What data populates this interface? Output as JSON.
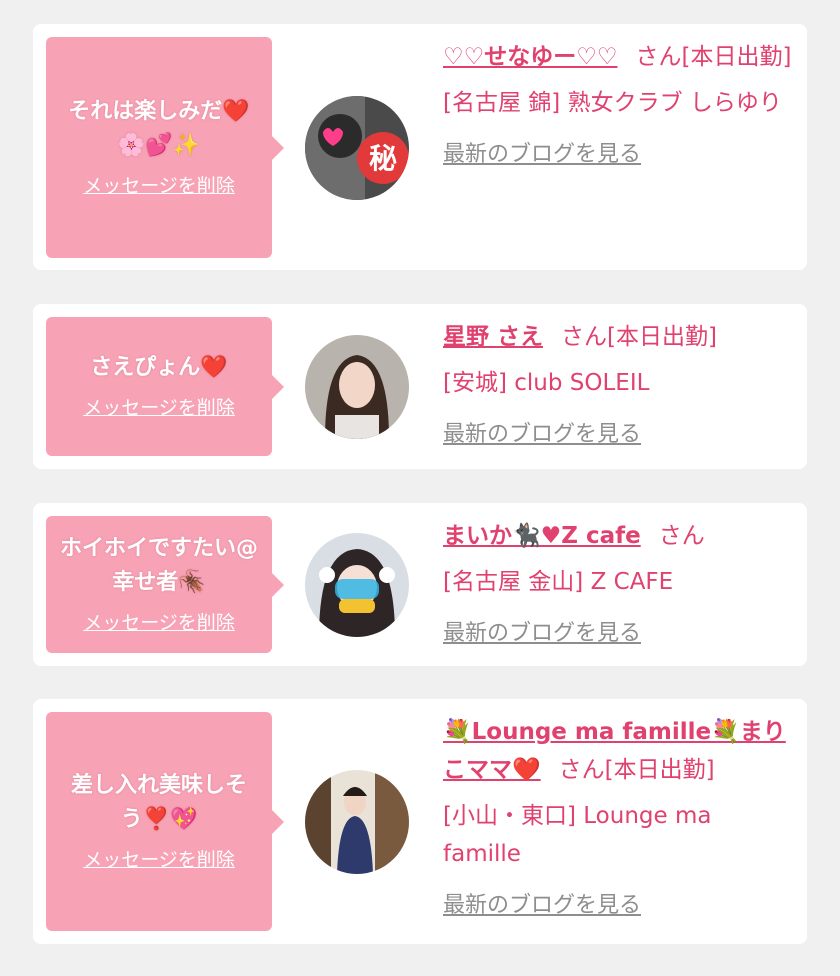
{
  "delete_label": "メッセージを削除",
  "blog_label": "最新のブログを見る",
  "colors": {
    "background": "#f0f0f0",
    "card": "#ffffff",
    "bubble": "#f7a3b5",
    "accent": "#e0416e",
    "link_gray": "#8e8e8e"
  },
  "items": [
    {
      "message": "それは楽しみだ❤️🌸💕✨",
      "cast_name": "♡♡せなゆー♡♡",
      "status": "さん[本日出勤]",
      "shop": "[名古屋 錦] 熟女クラブ しらゆり",
      "avatar_icon": "avatar-photo-icon"
    },
    {
      "message": "さえぴょん❤️",
      "cast_name": "星野 さえ",
      "status": "さん[本日出勤]",
      "shop": "[安城] club SOLEIL",
      "avatar_icon": "avatar-photo-icon"
    },
    {
      "message": "ホイホイですたい@幸せ者🪳",
      "cast_name": "まいか🐈‍⬛♥Z cafe",
      "status": "さん",
      "shop": "[名古屋 金山] Z CAFE",
      "avatar_icon": "avatar-photo-icon"
    },
    {
      "message": "差し入れ美味しそう❣️💖",
      "cast_name": "💐Lounge ma famille💐まりこママ❤️",
      "status": "さん[本日出勤]",
      "shop": "[小山・東口] Lounge ma famille",
      "avatar_icon": "avatar-photo-icon"
    }
  ]
}
